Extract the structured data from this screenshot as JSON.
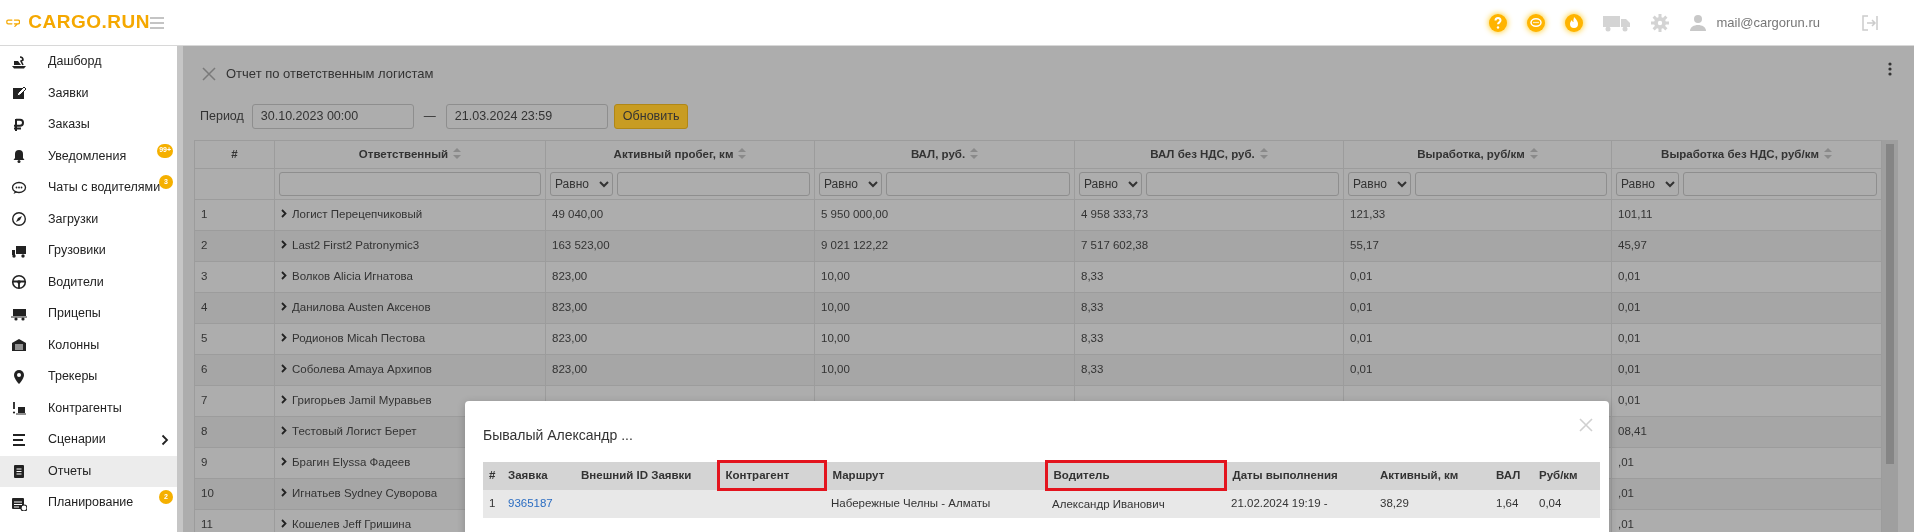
{
  "logo": {
    "text": "CARGO.RUN"
  },
  "header": {
    "user_email": "mail@cargorun.ru"
  },
  "sidebar": {
    "items": [
      {
        "label": "Дашборд",
        "selected": false,
        "has_submenu": false
      },
      {
        "label": "Заявки",
        "selected": false,
        "has_submenu": false
      },
      {
        "label": "Заказы",
        "selected": false,
        "has_submenu": false
      },
      {
        "label": "Уведомления",
        "selected": false,
        "has_submenu": false,
        "badge": "99+"
      },
      {
        "label": "Чаты с водителями",
        "selected": false,
        "has_submenu": false,
        "badge": "3"
      },
      {
        "label": "Загрузки",
        "selected": false,
        "has_submenu": false
      },
      {
        "label": "Грузовики",
        "selected": false,
        "has_submenu": false
      },
      {
        "label": "Водители",
        "selected": false,
        "has_submenu": false
      },
      {
        "label": "Прицепы",
        "selected": false,
        "has_submenu": false
      },
      {
        "label": "Колонны",
        "selected": false,
        "has_submenu": false
      },
      {
        "label": "Трекеры",
        "selected": false,
        "has_submenu": false
      },
      {
        "label": "Контрагенты",
        "selected": false,
        "has_submenu": false
      },
      {
        "label": "Сценарии",
        "selected": false,
        "has_submenu": true
      },
      {
        "label": "Отчеты",
        "selected": true,
        "has_submenu": false
      },
      {
        "label": "Планирование",
        "selected": false,
        "has_submenu": false,
        "badge": "2"
      }
    ]
  },
  "report": {
    "title": "Отчет по ответственным логистам",
    "period": {
      "label": "Период",
      "from": "30.10.2023 00:00",
      "separator": "—",
      "to": "21.03.2024 23:59",
      "button": "Обновить"
    },
    "table": {
      "columns": [
        {
          "label": "#",
          "sortable": false,
          "kind": "plain"
        },
        {
          "label": "Ответственный",
          "sortable": true,
          "kind": "text"
        },
        {
          "label": "Активный пробег, км",
          "sortable": true,
          "kind": "compare",
          "operator": "Равно"
        },
        {
          "label": "ВАЛ, руб.",
          "sortable": true,
          "kind": "compare",
          "operator": "Равно"
        },
        {
          "label": "ВАЛ без НДС, руб.",
          "sortable": true,
          "kind": "compare",
          "operator": "Равно"
        },
        {
          "label": "Выработка, руб/км",
          "sortable": true,
          "kind": "compare",
          "operator": "Равно"
        },
        {
          "label": "Выработка без НДС, руб/км",
          "sortable": true,
          "kind": "compare",
          "operator": "Равно"
        }
      ],
      "rows": [
        {
          "cells": [
            "1",
            "Логист Перецепчиковый",
            "49 040,00",
            "5 950 000,00",
            "4 958 333,73",
            "121,33",
            "101,11"
          ]
        },
        {
          "cells": [
            "2",
            "Last2 First2 Patronymic3",
            "163 523,00",
            "9 021 122,22",
            "7 517 602,38",
            "55,17",
            "45,97"
          ]
        },
        {
          "cells": [
            "3",
            "Волков Alicia Игнатова",
            "823,00",
            "10,00",
            "8,33",
            "0,01",
            "0,01"
          ]
        },
        {
          "cells": [
            "4",
            "Данилова Austen Аксенов",
            "823,00",
            "10,00",
            "8,33",
            "0,01",
            "0,01"
          ]
        },
        {
          "cells": [
            "5",
            "Родионов Micah Пестова",
            "823,00",
            "10,00",
            "8,33",
            "0,01",
            "0,01"
          ]
        },
        {
          "cells": [
            "6",
            "Соболева Amaya Архипов",
            "823,00",
            "10,00",
            "8,33",
            "0,01",
            "0,01"
          ]
        },
        {
          "cells": [
            "7",
            "Григорьев Jamil Муравьев",
            null,
            null,
            null,
            null,
            "0,01"
          ]
        },
        {
          "cells": [
            "8",
            "Тестовый Логист Берет",
            null,
            null,
            null,
            null,
            "08,41"
          ]
        },
        {
          "cells": [
            "9",
            "Брагин Elyssa Фадеев",
            null,
            null,
            null,
            null,
            ",01"
          ]
        },
        {
          "cells": [
            "10",
            "Игнатьев Sydney Суворова",
            null,
            null,
            null,
            null,
            ",01"
          ]
        },
        {
          "cells": [
            "11",
            "Кошелев Jeff Гришина",
            null,
            null,
            null,
            null,
            ",01"
          ]
        }
      ]
    }
  },
  "modal": {
    "title": "Бывалый Александр ...",
    "columns": [
      {
        "label": "#",
        "highlighted": false
      },
      {
        "label": "Заявка",
        "highlighted": false
      },
      {
        "label": "Внешний ID Заявки",
        "highlighted": false
      },
      {
        "label": "Контрагент",
        "highlighted": true
      },
      {
        "label": "Маршрут",
        "highlighted": false
      },
      {
        "label": "Водитель",
        "highlighted": true
      },
      {
        "label": "Даты выполнения",
        "highlighted": false
      },
      {
        "label": "Активный, км",
        "highlighted": false
      },
      {
        "label": "ВАЛ",
        "highlighted": false
      },
      {
        "label": "Руб/км",
        "highlighted": false
      }
    ],
    "rows": [
      {
        "number": "1",
        "order": "9365187",
        "route": "Набережные Челны - Алматы",
        "driver": "Александр Иванович",
        "dates": "21.02.2024 19:19 -",
        "active_km": "38,29",
        "val": "1,64",
        "rub_per_km": "0,04"
      }
    ]
  }
}
